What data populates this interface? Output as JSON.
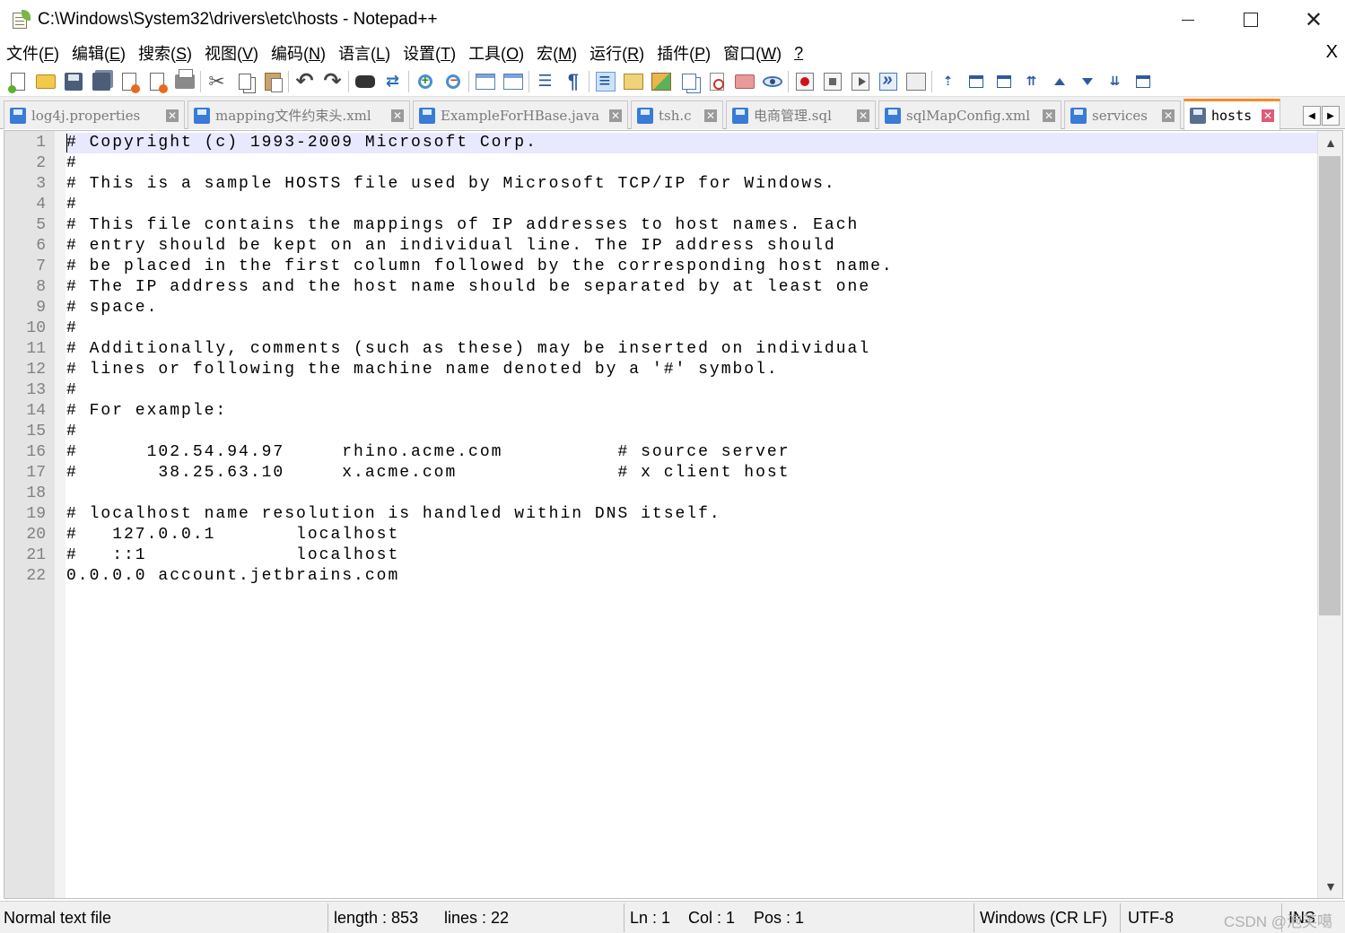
{
  "window": {
    "title": "C:\\Windows\\System32\\drivers\\etc\\hosts - Notepad++",
    "minimize": "",
    "maximize": "",
    "close": "✕"
  },
  "menu": {
    "items": [
      {
        "label": "文件(",
        "key": "F",
        "end": ")"
      },
      {
        "label": "编辑(",
        "key": "E",
        "end": ")"
      },
      {
        "label": "搜索(",
        "key": "S",
        "end": ")"
      },
      {
        "label": "视图(",
        "key": "V",
        "end": ")"
      },
      {
        "label": "编码(",
        "key": "N",
        "end": ")"
      },
      {
        "label": "语言(",
        "key": "L",
        "end": ")"
      },
      {
        "label": "设置(",
        "key": "T",
        "end": ")"
      },
      {
        "label": "工具(",
        "key": "O",
        "end": ")"
      },
      {
        "label": "宏(",
        "key": "M",
        "end": ")"
      },
      {
        "label": "运行(",
        "key": "R",
        "end": ")"
      },
      {
        "label": "插件(",
        "key": "P",
        "end": ")"
      },
      {
        "label": "窗口(",
        "key": "W",
        "end": ")"
      },
      {
        "label": "",
        "key": "?",
        "end": ""
      }
    ],
    "close_doc": "X"
  },
  "tabs": [
    {
      "label": "log4j.properties",
      "active": false
    },
    {
      "label": "mapping文件约束头.xml",
      "active": false
    },
    {
      "label": "ExampleForHBase.java",
      "active": false
    },
    {
      "label": "tsh.c",
      "active": false
    },
    {
      "label": "电商管理.sql",
      "active": false
    },
    {
      "label": "sqlMapConfig.xml",
      "active": false
    },
    {
      "label": "services",
      "active": false
    },
    {
      "label": "hosts",
      "active": true
    }
  ],
  "tab_close_glyph": "✕",
  "tab_scroll": {
    "left": "◀",
    "right": "▶"
  },
  "editor": {
    "lines": [
      "# Copyright (c) 1993-2009 Microsoft Corp.",
      "#",
      "# This is a sample HOSTS file used by Microsoft TCP/IP for Windows.",
      "#",
      "# This file contains the mappings of IP addresses to host names. Each",
      "# entry should be kept on an individual line. The IP address should",
      "# be placed in the first column followed by the corresponding host name.",
      "# The IP address and the host name should be separated by at least one",
      "# space.",
      "#",
      "# Additionally, comments (such as these) may be inserted on individual",
      "# lines or following the machine name denoted by a '#' symbol.",
      "#",
      "# For example:",
      "#",
      "#      102.54.94.97     rhino.acme.com          # source server",
      "#       38.25.63.10     x.acme.com              # x client host",
      "",
      "# localhost name resolution is handled within DNS itself.",
      "#   127.0.0.1       localhost",
      "#   ::1             localhost",
      "0.0.0.0 account.jetbrains.com"
    ],
    "line_numbers": [
      "1",
      "2",
      "3",
      "4",
      "5",
      "6",
      "7",
      "8",
      "9",
      "10",
      "11",
      "12",
      "13",
      "14",
      "15",
      "16",
      "17",
      "18",
      "19",
      "20",
      "21",
      "22"
    ],
    "current_line_highlight": "#e8e8ff",
    "scroll_up": "▲",
    "scroll_down": "▼"
  },
  "status": {
    "file_type": "Normal text file",
    "length": "length : 853",
    "lines": "lines : 22",
    "ln": "Ln : 1",
    "col": "Col : 1",
    "pos": "Pos : 1",
    "eol": "Windows (CR LF)",
    "encoding": "UTF-8",
    "ins": "INS",
    "watermark": "CSDN @泡芙噶"
  },
  "toolbar_icons": [
    "new-file-icon",
    "open-file-icon",
    "save-icon",
    "save-all-icon",
    "close-file-icon",
    "close-all-icon",
    "print-icon",
    "cut-icon",
    "copy-icon",
    "paste-icon",
    "undo-icon",
    "redo-icon",
    "find-icon",
    "replace-icon",
    "zoom-in-icon",
    "zoom-out-icon",
    "sync-vertical-icon",
    "sync-horizontal-icon",
    "word-wrap-icon",
    "show-all-chars-icon",
    "indent-guide-icon",
    "fold-icon",
    "document-map-icon",
    "document-list-icon",
    "function-list-icon",
    "folder-workspace-icon",
    "monitor-icon",
    "record-macro-icon",
    "stop-macro-icon",
    "play-macro-icon",
    "run-macro-multiple-icon",
    "save-macro-icon",
    "plugin-a-icon",
    "plugin-b-icon",
    "plugin-c-icon",
    "plugin-d-icon",
    "plugin-up-icon",
    "plugin-down-icon",
    "plugin-e-icon",
    "plugin-f-icon"
  ],
  "colors": {
    "active_tab_accent": "#fa8c1e",
    "tab_close_active": "#e05a7a",
    "gutter": "#e4e4e4"
  }
}
